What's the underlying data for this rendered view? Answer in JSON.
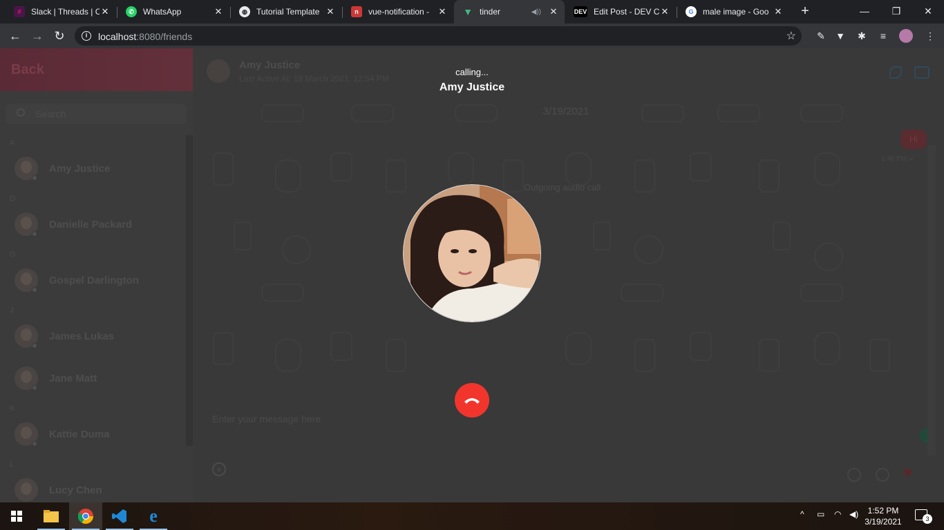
{
  "browser": {
    "tabs": [
      {
        "title": "Slack | Threads | Co",
        "icon": "slack-icon",
        "active": false
      },
      {
        "title": "WhatsApp",
        "icon": "whatsapp-icon",
        "active": false
      },
      {
        "title": "Tutorial Template",
        "icon": "globe-icon",
        "active": false
      },
      {
        "title": "vue-notification -",
        "icon": "npm-icon",
        "active": false
      },
      {
        "title": "tinder",
        "icon": "vue-icon",
        "active": true
      },
      {
        "title": "Edit Post - DEV Co",
        "icon": "dev-icon",
        "active": false
      },
      {
        "title": "male image - Goo",
        "icon": "google-icon",
        "active": false
      }
    ],
    "url_host": "localhost",
    "url_rest": ":8080/friends"
  },
  "sidebar": {
    "back_label": "Back",
    "search_placeholder": "Search",
    "groups": [
      {
        "letter": "A",
        "friends": [
          "Amy Justice"
        ]
      },
      {
        "letter": "D",
        "friends": [
          "Danielle Packard"
        ]
      },
      {
        "letter": "G",
        "friends": [
          "Gospel Darlington"
        ]
      },
      {
        "letter": "J",
        "friends": [
          "James Lukas",
          "Jane Matt"
        ]
      },
      {
        "letter": "K",
        "friends": [
          "Kattie Duma"
        ]
      },
      {
        "letter": "L",
        "friends": [
          "Lucy Chen"
        ]
      }
    ]
  },
  "chat": {
    "name": "Amy Justice",
    "last_active": "Last Active At: 18 March 2021, 12:54 PM",
    "date": "3/19/2021",
    "message": "Hi",
    "message_time": "1:40 PM",
    "outgoing_note": "Outgoing audio call",
    "input_placeholder": "Enter your message here"
  },
  "call": {
    "status": "calling...",
    "name": "Amy Justice"
  },
  "taskbar": {
    "time": "1:52 PM",
    "date": "3/19/2021",
    "notifications": "3"
  },
  "colors": {
    "hangup": "#f2352c",
    "accent_vscode": "#1e88d6"
  }
}
